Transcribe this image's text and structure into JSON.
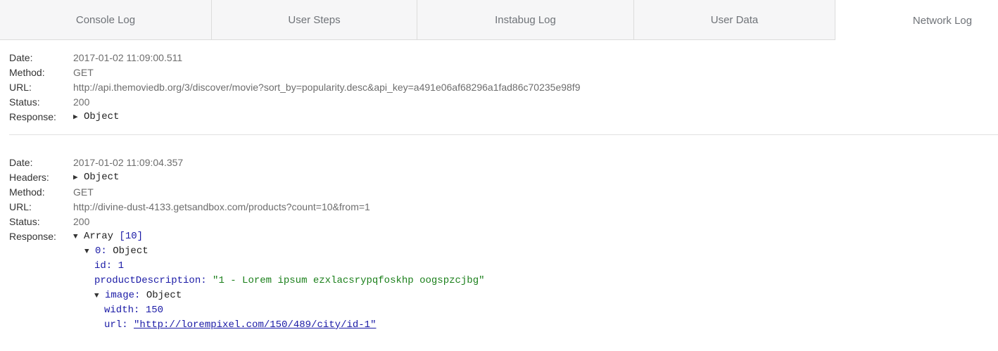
{
  "tabs": [
    {
      "label": "Console Log"
    },
    {
      "label": "User Steps"
    },
    {
      "label": "Instabug Log"
    },
    {
      "label": "User Data"
    },
    {
      "label": "Network Log"
    }
  ],
  "labels": {
    "date": "Date:",
    "method": "Method:",
    "url": "URL:",
    "status": "Status:",
    "response": "Response:",
    "headers": "Headers:"
  },
  "glyphs": {
    "collapsed": "▶",
    "expanded": "▼"
  },
  "entries": [
    {
      "date": "2017-01-02 11:09:00.511",
      "method": "GET",
      "url": "http://api.themoviedb.org/3/discover/movie?sort_by=popularity.desc&api_key=a491e06af68296a1fad86c70235e98f9",
      "status": "200",
      "response": "Object"
    },
    {
      "date": "2017-01-02 11:09:04.357",
      "headers": "Object",
      "method": "GET",
      "url": "http://divine-dust-4133.getsandbox.com/products?count=10&from=1",
      "status": "200",
      "response": {
        "type": "Array",
        "count": "[10]",
        "item_key": "0:",
        "item_type": "Object",
        "id_key": "id:",
        "id_val": "1",
        "desc_key": "productDescription:",
        "desc_val": "\"1 - Lorem ipsum ezxlacsrypqfoskhp oogspzcjbg\"",
        "image_key": "image:",
        "image_type": "Object",
        "width_key": "width:",
        "width_val": "150",
        "url_key": "url:",
        "url_val": "\"http://lorempixel.com/150/489/city/id-1\""
      }
    }
  ]
}
